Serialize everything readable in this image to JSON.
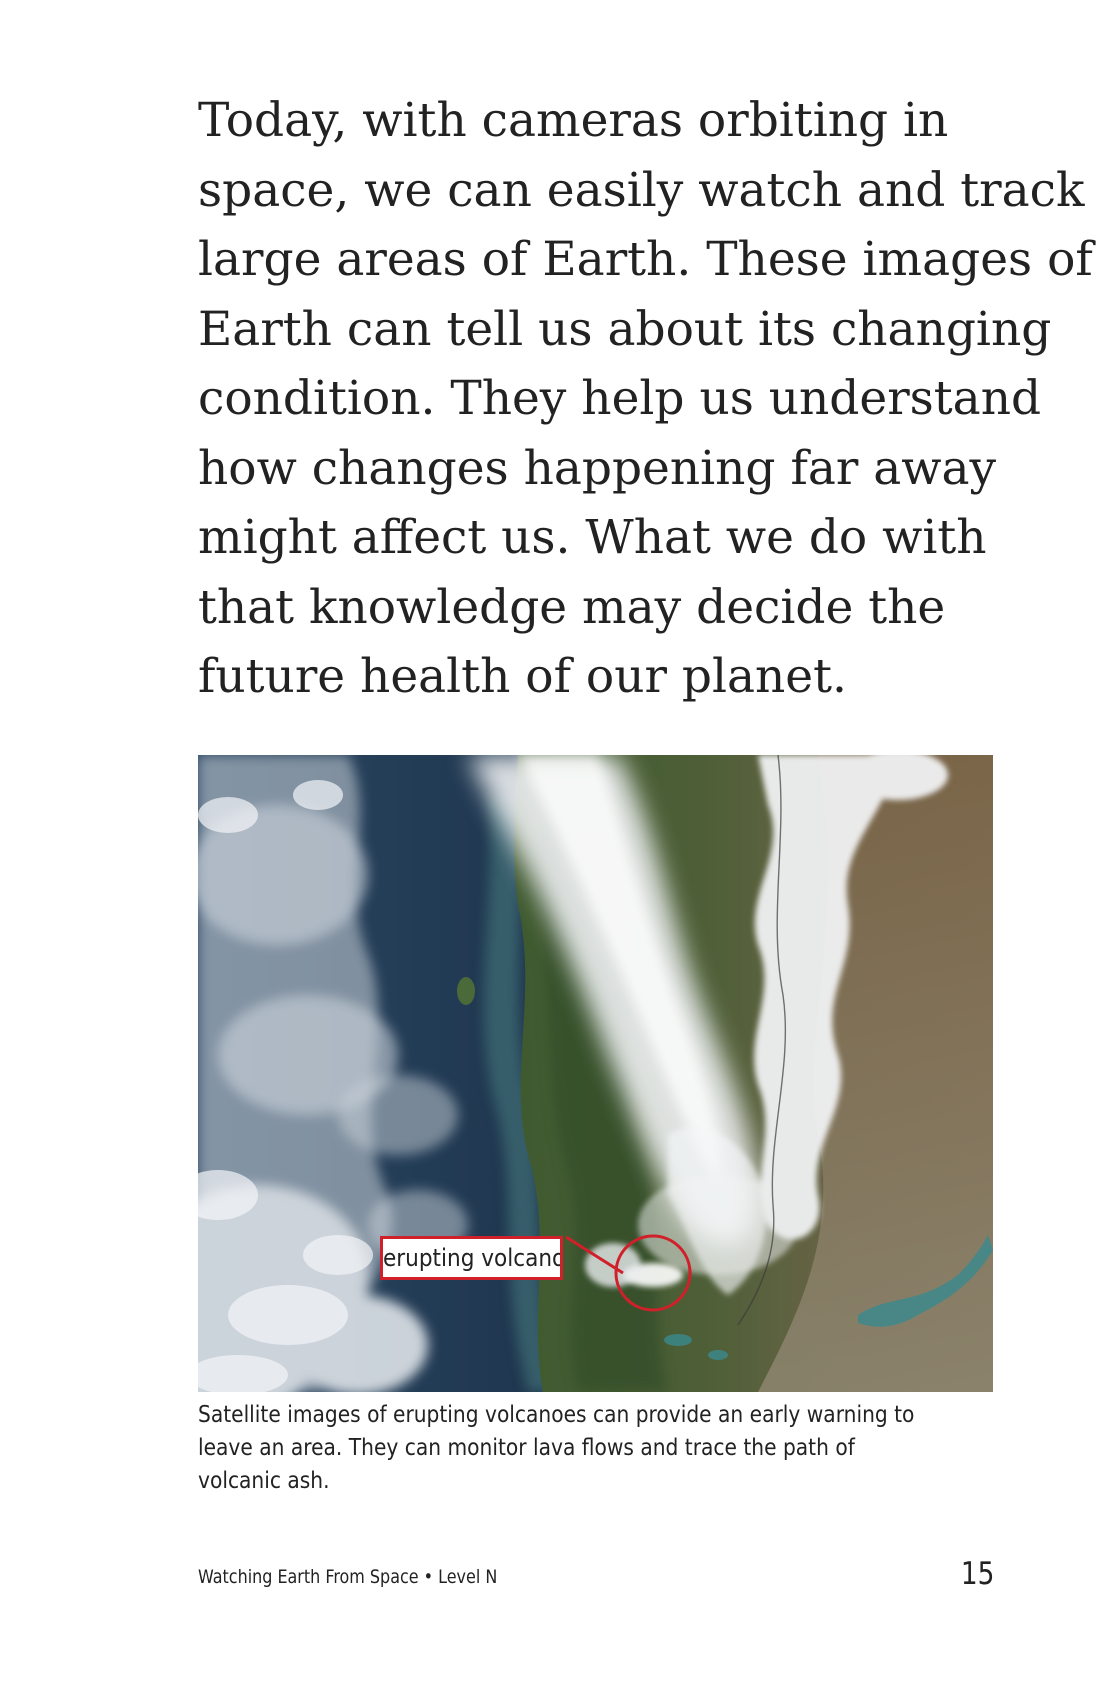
{
  "body": {
    "lines": [
      "Today, with cameras orbiting in",
      "space, we can easily watch and track",
      "large areas of Earth. These images of",
      "Earth can tell us about its changing",
      "condition. They help us understand",
      "how changes happening far away",
      "might affect us. What we do with",
      "that knowledge may decide the",
      "future health of our planet."
    ]
  },
  "figure": {
    "callout_label": "erupting volcano",
    "callout_color": "#d0202a",
    "caption_lines": [
      "Satellite images of erupting volcanoes can provide an early warning to",
      "leave an area. They can monitor lava flows and trace the path of",
      "volcanic ash."
    ]
  },
  "footer": {
    "title": "Watching Earth From Space • Level N",
    "page_number": "15"
  }
}
